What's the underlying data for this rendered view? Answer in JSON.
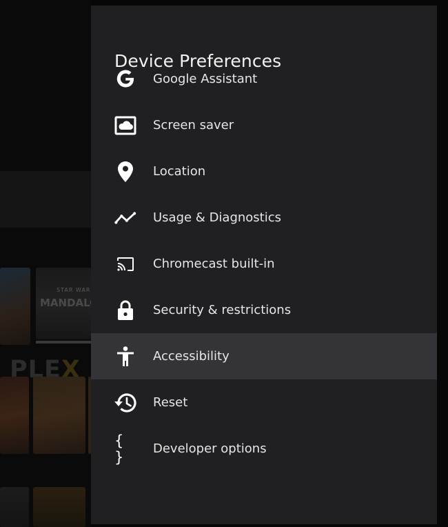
{
  "background": {
    "logo_text": "PLE",
    "logo_accent": "X",
    "tiles": [
      {
        "kicker": "STAR WARS",
        "caption": "MANDALOR"
      }
    ]
  },
  "panel": {
    "title": "Device Preferences",
    "items": [
      {
        "label": "Google Assistant",
        "icon": "google-g-icon"
      },
      {
        "label": "Screen saver",
        "icon": "screen-saver-icon"
      },
      {
        "label": "Location",
        "icon": "location-pin-icon"
      },
      {
        "label": "Usage & Diagnostics",
        "icon": "diagnostics-graph-icon"
      },
      {
        "label": "Chromecast built-in",
        "icon": "cast-icon"
      },
      {
        "label": "Security & restrictions",
        "icon": "lock-icon"
      },
      {
        "label": "Accessibility",
        "icon": "accessibility-icon",
        "selected": true
      },
      {
        "label": "Reset",
        "icon": "reset-history-icon"
      },
      {
        "label": "Developer options",
        "icon": "braces-icon",
        "glyph": "{ }"
      }
    ]
  },
  "colors": {
    "panel_bg": "#202023",
    "selected_row_bg": "#343438",
    "text_primary": "#e6e6e6",
    "title": "#f2f2f2",
    "plex_accent": "#3b2f12"
  }
}
